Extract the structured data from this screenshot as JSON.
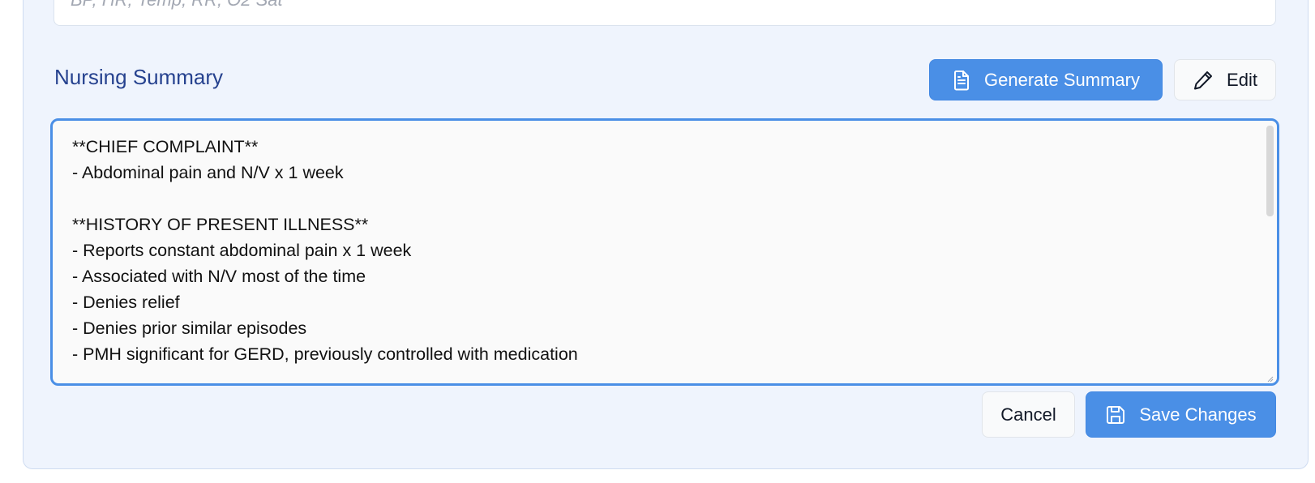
{
  "vitals": {
    "placeholder": "BP, HR, Temp, RR, O2 Sat"
  },
  "summary": {
    "title": "Nursing Summary",
    "generate_label": "Generate Summary",
    "generate_icon": "document-icon",
    "edit_label": "Edit",
    "edit_icon": "pencil-icon",
    "lines": [
      "**CHIEF COMPLAINT**",
      "- Abdominal pain and N/V x 1 week",
      "",
      "**HISTORY OF PRESENT ILLNESS**",
      "- Reports constant abdominal pain x 1 week",
      "- Associated with N/V most of the time",
      "- Denies relief",
      "- Denies prior similar episodes",
      "- PMH significant for GERD, previously controlled with medication"
    ],
    "cancel_label": "Cancel",
    "save_label": "Save Changes",
    "save_icon": "floppy-disk-icon"
  },
  "colors": {
    "accent": "#4a8fe6",
    "panel_bg": "#eff4fd",
    "title": "#26428f"
  }
}
